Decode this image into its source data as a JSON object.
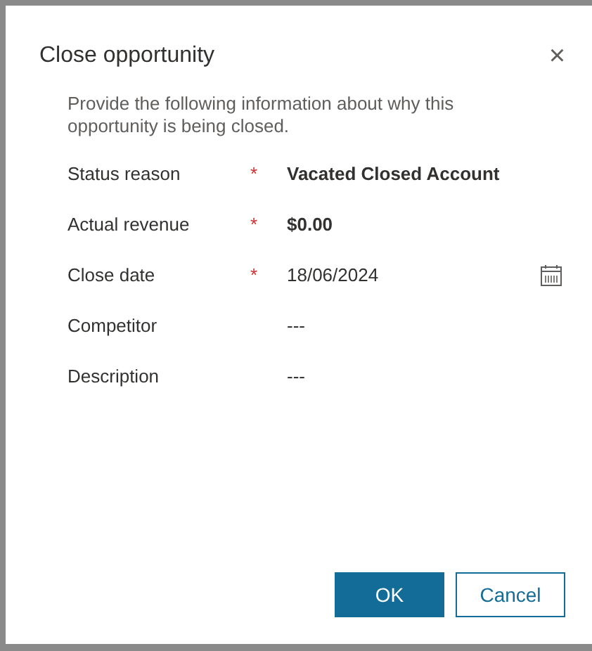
{
  "dialog": {
    "title": "Close opportunity",
    "close": "×",
    "intro": "Provide the following information about why this opportunity is being closed."
  },
  "fields": [
    {
      "label": "Status reason",
      "required_mark": "*",
      "value": "Vacated Closed Account",
      "kind": "option"
    },
    {
      "label": "Actual revenue",
      "required_mark": "*",
      "value": "$0.00",
      "kind": "currency"
    },
    {
      "label": "Close date",
      "required_mark": "*",
      "value": "18/06/2024",
      "kind": "date"
    },
    {
      "label": "Competitor",
      "value": "---",
      "kind": "lookup"
    },
    {
      "label": "Description",
      "value": "---",
      "kind": "text"
    }
  ],
  "buttons": [
    {
      "label": "OK",
      "kind": "primary"
    },
    {
      "label": "Cancel",
      "kind": "secondary"
    }
  ]
}
